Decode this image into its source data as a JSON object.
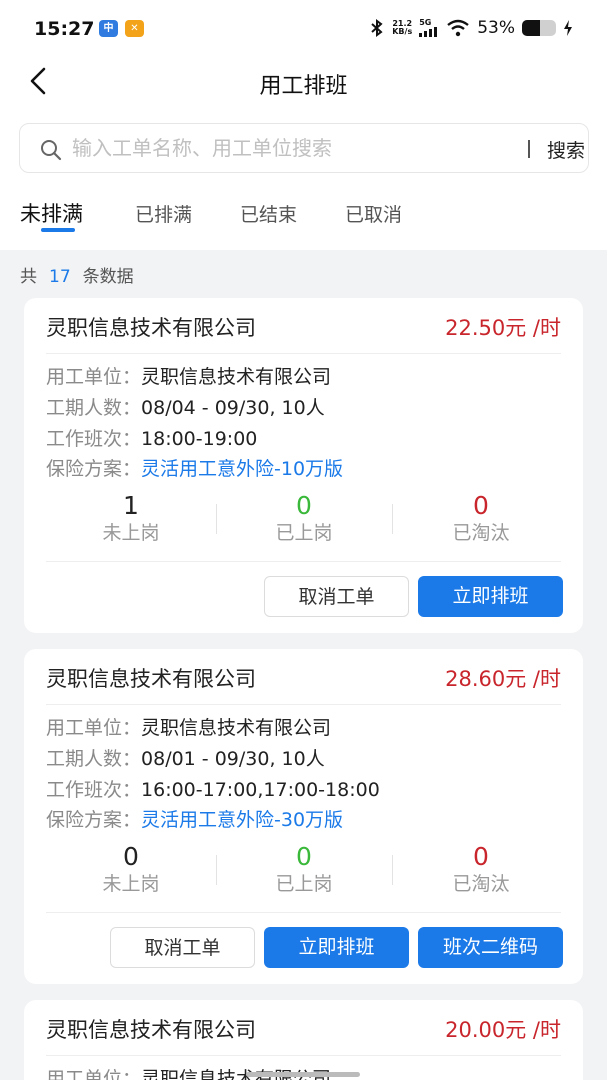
{
  "status_bar": {
    "time": "15:27",
    "net_speed_value": "21.2",
    "net_speed_unit": "KB/s",
    "network": "5G",
    "battery": "53%",
    "battery_level": 0.53
  },
  "header": {
    "title": "用工排班"
  },
  "search": {
    "placeholder": "输入工单名称、用工单位搜索",
    "button": "搜索"
  },
  "tabs": [
    "未排满",
    "已排满",
    "已结束",
    "已取消"
  ],
  "active_tab": 0,
  "summary": {
    "prefix": "共",
    "count": "17",
    "suffix": "条数据"
  },
  "labels": {
    "unit": "用工单位：",
    "period": "工期人数：",
    "shift": "工作班次：",
    "insurance": "保险方案："
  },
  "stat_labels": {
    "pending": "未上岗",
    "onboard": "已上岗",
    "eliminated": "已淘汰"
  },
  "colors": {
    "accent": "#1b7ae8",
    "price": "#c8262c",
    "green": "#3ab83a",
    "red": "#c8262c"
  },
  "cards": [
    {
      "company": "灵职信息技术有限公司",
      "price": "22.50元 /时",
      "unit": "灵职信息技术有限公司",
      "period": "08/04 - 09/30, 10人",
      "shift": "18:00-19:00",
      "insurance": "灵活用工意外险-10万版",
      "pending": "1",
      "onboard": "0",
      "eliminated": "0",
      "buttons": [
        "取消工单",
        "立即排班"
      ]
    },
    {
      "company": "灵职信息技术有限公司",
      "price": "28.60元 /时",
      "unit": "灵职信息技术有限公司",
      "period": "08/01 - 09/30, 10人",
      "shift": "16:00-17:00,17:00-18:00",
      "insurance": "灵活用工意外险-30万版",
      "pending": "0",
      "onboard": "0",
      "eliminated": "0",
      "buttons": [
        "取消工单",
        "立即排班",
        "班次二维码"
      ]
    },
    {
      "company": "灵职信息技术有限公司",
      "price": "20.00元 /时",
      "unit": "灵职信息技术有限公司"
    }
  ]
}
